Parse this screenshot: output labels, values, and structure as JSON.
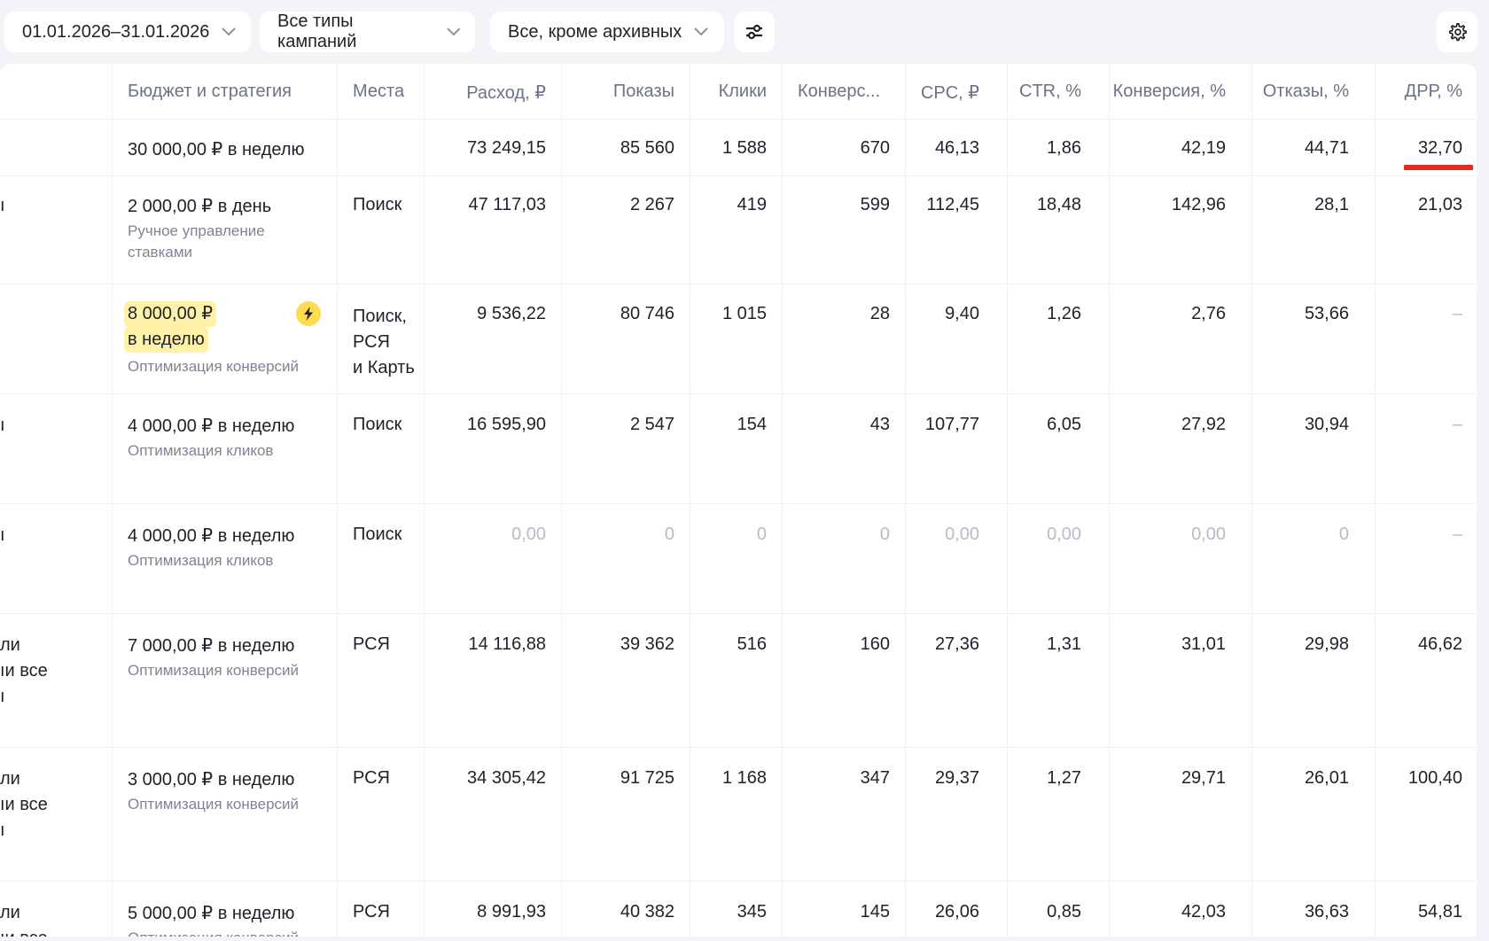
{
  "filters": {
    "date_range": "01.01.2026–31.01.2026",
    "campaign_types": "Все типы кампаний",
    "status": "Все, кроме архивных"
  },
  "icons": {
    "filter_settings": "sliders-icon",
    "settings": "gear-icon",
    "chevron": "chevron-down-icon",
    "autobudget": "lightning-icon"
  },
  "colors": {
    "accent_underline": "#e52b1e",
    "highlight": "#fff1a8",
    "bolt": "#ffdb4d"
  },
  "columns": {
    "budget": "Бюджет и стратегия",
    "places": "Места",
    "spend": "Расход, ₽",
    "impressions": "Показы",
    "clicks": "Клики",
    "conversions": "Конверс...",
    "cpc": "CPC, ₽",
    "ctr": "CTR, %",
    "conv_rate": "Конверсия, %",
    "bounce": "Отказы, %",
    "drr": "ДРР, %"
  },
  "total": {
    "budget": "30 000,00 ₽ в неделю",
    "spend": "73 249,15",
    "impressions": "85 560",
    "clicks": "1 588",
    "conversions": "670",
    "cpc": "46,13",
    "ctr": "1,86",
    "conv_rate": "42,19",
    "bounce": "44,71",
    "drr": "32,70"
  },
  "rows": [
    {
      "name": "ı",
      "budget": "2 000,00 ₽ в день",
      "strategy": "Ручное управление\nставками",
      "places": "Поиск",
      "spend": "47 117,03",
      "impressions": "2 267",
      "clicks": "419",
      "conversions": "599",
      "cpc": "112,45",
      "ctr": "18,48",
      "conv_rate": "142,96",
      "bounce": "28,1",
      "drr": "21,03"
    },
    {
      "name": "",
      "budget_line1": "8 000,00 ₽",
      "budget_line2": "в неделю",
      "strategy": "Оптимизация конверсий",
      "places": "Поиск,\nРСЯ\nи Карть",
      "spend": "9 536,22",
      "impressions": "80 746",
      "clicks": "1 015",
      "conversions": "28",
      "cpc": "9,40",
      "ctr": "1,26",
      "conv_rate": "2,76",
      "bounce": "53,66",
      "drr": "–"
    },
    {
      "name": "ı",
      "budget": "4 000,00 ₽ в неделю",
      "strategy": "Оптимизация кликов",
      "places": "Поиск",
      "spend": "16 595,90",
      "impressions": "2 547",
      "clicks": "154",
      "conversions": "43",
      "cpc": "107,77",
      "ctr": "6,05",
      "conv_rate": "27,92",
      "bounce": "30,94",
      "drr": "–"
    },
    {
      "name": "ı",
      "budget": "4 000,00 ₽ в неделю",
      "strategy": "Оптимизация кликов",
      "places": "Поиск",
      "spend": "0,00",
      "impressions": "0",
      "clicks": "0",
      "conversions": "0",
      "cpc": "0,00",
      "ctr": "0,00",
      "conv_rate": "0,00",
      "bounce": "0",
      "drr": "–"
    },
    {
      "name": "ли\nıи все\nı",
      "budget": "7 000,00 ₽ в неделю",
      "strategy": "Оптимизация конверсий",
      "places": "РСЯ",
      "spend": "14 116,88",
      "impressions": "39 362",
      "clicks": "516",
      "conversions": "160",
      "cpc": "27,36",
      "ctr": "1,31",
      "conv_rate": "31,01",
      "bounce": "29,98",
      "drr": "46,62"
    },
    {
      "name": "ли\nıи все\nı",
      "budget": "3 000,00 ₽ в неделю",
      "strategy": "Оптимизация конверсий",
      "places": "РСЯ",
      "spend": "34 305,42",
      "impressions": "91 725",
      "clicks": "1 168",
      "conversions": "347",
      "cpc": "29,37",
      "ctr": "1,27",
      "conv_rate": "29,71",
      "bounce": "26,01",
      "drr": "100,40"
    },
    {
      "name": "ли\nıи все",
      "budget": "5 000,00 ₽ в неделю",
      "strategy": "Оптимизация конверсий",
      "places": "РСЯ",
      "spend": "8 991,93",
      "impressions": "40 382",
      "clicks": "345",
      "conversions": "145",
      "cpc": "26,06",
      "ctr": "0,85",
      "conv_rate": "42,03",
      "bounce": "36,63",
      "drr": "54,81"
    }
  ]
}
